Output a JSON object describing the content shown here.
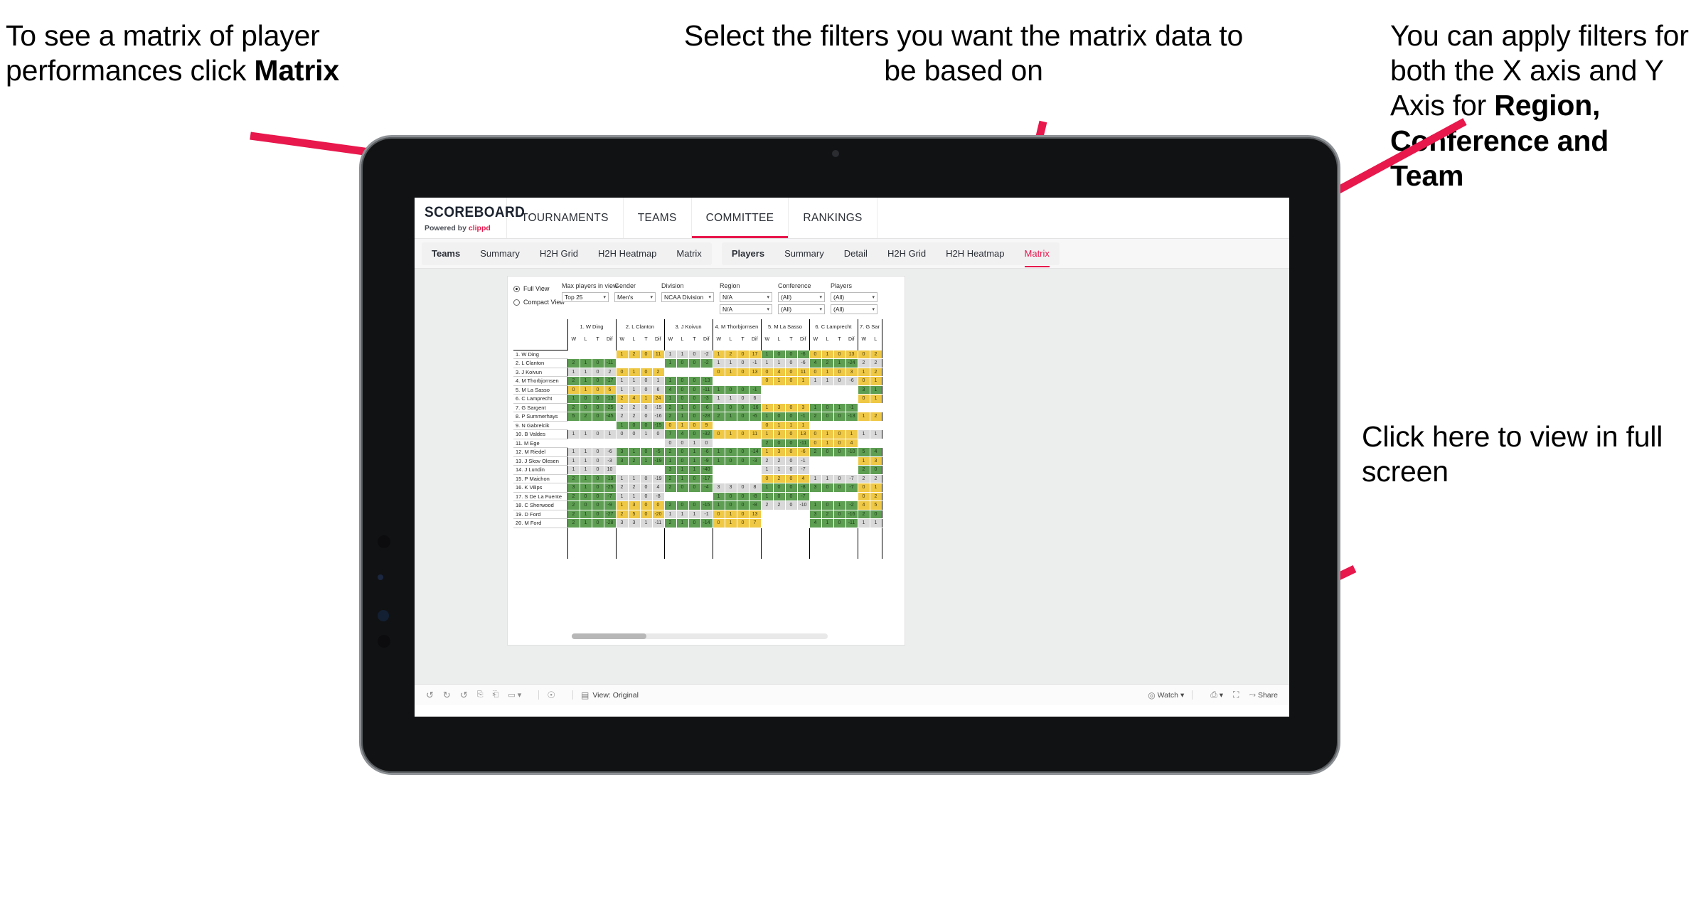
{
  "annotations": {
    "matrix_hint_pre": "To see a matrix of player performances click ",
    "matrix_hint_bold": "Matrix",
    "filters_hint": "Select the filters you want the matrix data to be based on",
    "axes_hint_pre": "You  can apply filters for both the X axis and Y Axis for ",
    "axes_hint_bold": "Region, Conference and Team",
    "fullscreen_hint": "Click here to view in full screen"
  },
  "app": {
    "brand": {
      "name": "SCOREBOARD",
      "powered_prefix": "Powered by ",
      "powered_brand": "clippd"
    },
    "topnav": [
      "TOURNAMENTS",
      "TEAMS",
      "COMMITTEE",
      "RANKINGS"
    ],
    "topnav_active": "COMMITTEE",
    "subnav": {
      "teams_group": [
        "Teams",
        "Summary",
        "H2H Grid",
        "H2H Heatmap",
        "Matrix"
      ],
      "players_group": [
        "Players",
        "Summary",
        "Detail",
        "H2H Grid",
        "H2H Heatmap",
        "Matrix"
      ],
      "players_selected": "Matrix"
    }
  },
  "filters": {
    "view_modes": [
      {
        "label": "Full View",
        "selected": true
      },
      {
        "label": "Compact View",
        "selected": false
      }
    ],
    "fields": [
      {
        "label": "Max players in view",
        "value": "Top 25"
      },
      {
        "label": "Gender",
        "value": "Men's"
      },
      {
        "label": "Division",
        "value": "NCAA Division I"
      },
      {
        "label": "Region",
        "value": "N/A",
        "value2": "N/A"
      },
      {
        "label": "Conference",
        "value": "(All)",
        "value2": "(All)"
      },
      {
        "label": "Players",
        "value": "(All)",
        "value2": "(All)"
      }
    ]
  },
  "matrix": {
    "sub_headers": [
      "W",
      "L",
      "T",
      "Dif"
    ],
    "columns": [
      {
        "name": "1. W Ding",
        "subs": [
          "W",
          "L",
          "T",
          "Dif"
        ]
      },
      {
        "name": "2. L Clanton",
        "subs": [
          "W",
          "L",
          "T",
          "Dif"
        ]
      },
      {
        "name": "3. J Koivun",
        "subs": [
          "W",
          "L",
          "T",
          "Dif"
        ]
      },
      {
        "name": "4. M Thorbjornsen",
        "subs": [
          "W",
          "L",
          "T",
          "Dif"
        ]
      },
      {
        "name": "5. M La Sasso",
        "subs": [
          "W",
          "L",
          "T",
          "Dif"
        ]
      },
      {
        "name": "6. C Lamprecht",
        "subs": [
          "W",
          "L",
          "T",
          "Dif"
        ]
      },
      {
        "name": "7. G Sar",
        "subs": [
          "W",
          "L"
        ]
      }
    ],
    "rows": [
      {
        "label": "1. W Ding",
        "cells": [
          [
            "",
            "",
            "",
            ""
          ],
          [
            "1",
            "2",
            "0",
            "11"
          ],
          [
            "1",
            "1",
            "0",
            "-2"
          ],
          [
            "1",
            "2",
            "0",
            "17"
          ],
          [
            "1",
            "0",
            "0",
            "-6"
          ],
          [
            "0",
            "1",
            "0",
            "13"
          ],
          [
            "0",
            "2"
          ]
        ],
        "colors": [
          "e",
          "y",
          "n",
          "y",
          "g",
          "y",
          "y"
        ]
      },
      {
        "label": "2. L Clanton",
        "cells": [
          [
            "2",
            "1",
            "0",
            "-11"
          ],
          [
            "",
            "",
            "",
            ""
          ],
          [
            "1",
            "0",
            "0",
            "-2"
          ],
          [
            "1",
            "1",
            "0",
            "-1"
          ],
          [
            "1",
            "1",
            "0",
            "-6"
          ],
          [
            "4",
            "2",
            "1",
            "-24"
          ],
          [
            "2",
            "2"
          ]
        ],
        "colors": [
          "g",
          "e",
          "g",
          "n",
          "n",
          "g",
          "n"
        ]
      },
      {
        "label": "3. J Koivun",
        "cells": [
          [
            "1",
            "1",
            "0",
            "2"
          ],
          [
            "0",
            "1",
            "0",
            "2"
          ],
          [
            "",
            "",
            "",
            ""
          ],
          [
            "0",
            "1",
            "0",
            "13"
          ],
          [
            "0",
            "4",
            "0",
            "11"
          ],
          [
            "0",
            "1",
            "0",
            "3"
          ],
          [
            "1",
            "2"
          ]
        ],
        "colors": [
          "n",
          "y",
          "e",
          "y",
          "y",
          "y",
          "y"
        ]
      },
      {
        "label": "4. M Thorbjornsen",
        "cells": [
          [
            "2",
            "1",
            "0",
            "-17"
          ],
          [
            "1",
            "1",
            "0",
            "1"
          ],
          [
            "1",
            "0",
            "0",
            "-13"
          ],
          [
            "",
            "",
            "",
            ""
          ],
          [
            "0",
            "1",
            "0",
            "1"
          ],
          [
            "1",
            "1",
            "0",
            "-6"
          ],
          [
            "0",
            "1"
          ]
        ],
        "colors": [
          "g",
          "n",
          "g",
          "e",
          "y",
          "n",
          "y"
        ]
      },
      {
        "label": "5. M La Sasso",
        "cells": [
          [
            "0",
            "1",
            "0",
            "6"
          ],
          [
            "1",
            "1",
            "0",
            "6"
          ],
          [
            "4",
            "0",
            "0",
            "-11"
          ],
          [
            "1",
            "0",
            "0",
            "-1"
          ],
          [
            "",
            "",
            "",
            ""
          ],
          [
            "",
            "",
            "",
            ""
          ],
          [
            "3",
            "1"
          ]
        ],
        "colors": [
          "y",
          "n",
          "g",
          "g",
          "e",
          "e",
          "g"
        ]
      },
      {
        "label": "6. C Lamprecht",
        "cells": [
          [
            "1",
            "0",
            "0",
            "-13"
          ],
          [
            "2",
            "4",
            "1",
            "24"
          ],
          [
            "1",
            "0",
            "0",
            "-3"
          ],
          [
            "1",
            "1",
            "0",
            "6"
          ],
          [
            "",
            "",
            "",
            ""
          ],
          [
            "",
            "",
            "",
            ""
          ],
          [
            "0",
            "1"
          ]
        ],
        "colors": [
          "g",
          "y",
          "g",
          "n",
          "e",
          "e",
          "y"
        ]
      },
      {
        "label": "7. G Sargent",
        "cells": [
          [
            "2",
            "0",
            "0",
            "-25"
          ],
          [
            "2",
            "2",
            "0",
            "-15"
          ],
          [
            "2",
            "1",
            "0",
            "-6"
          ],
          [
            "1",
            "0",
            "0",
            "-16"
          ],
          [
            "1",
            "3",
            "0",
            "3"
          ],
          [
            "1",
            "0",
            "1",
            "-1"
          ],
          [
            "",
            ""
          ]
        ],
        "colors": [
          "g",
          "n",
          "g",
          "g",
          "y",
          "g",
          "e"
        ]
      },
      {
        "label": "8. P Summerhays",
        "cells": [
          [
            "5",
            "2",
            "0",
            "-45"
          ],
          [
            "2",
            "2",
            "0",
            "-16"
          ],
          [
            "2",
            "1",
            "0",
            "-28"
          ],
          [
            "2",
            "1",
            "0",
            "-6"
          ],
          [
            "1",
            "0",
            "0",
            "-1"
          ],
          [
            "2",
            "0",
            "0",
            "-13"
          ],
          [
            "1",
            "2"
          ]
        ],
        "colors": [
          "g",
          "n",
          "g",
          "g",
          "g",
          "g",
          "y"
        ]
      },
      {
        "label": "9. N Gabrelcik",
        "cells": [
          [
            "",
            "",
            "",
            ""
          ],
          [
            "1",
            "0",
            "0",
            "-15"
          ],
          [
            "0",
            "1",
            "0",
            "9"
          ],
          [
            "",
            "",
            "",
            ""
          ],
          [
            "0",
            "1",
            "1",
            "1"
          ],
          [
            "",
            "",
            "",
            ""
          ],
          [
            "",
            ""
          ]
        ],
        "colors": [
          "e",
          "g",
          "y",
          "e",
          "y",
          "e",
          "e"
        ]
      },
      {
        "label": "10. B Valdes",
        "cells": [
          [
            "1",
            "1",
            "0",
            "1"
          ],
          [
            "0",
            "0",
            "1",
            "0"
          ],
          [
            "7",
            "4",
            "0",
            "-32"
          ],
          [
            "0",
            "1",
            "0",
            "11"
          ],
          [
            "1",
            "3",
            "0",
            "13"
          ],
          [
            "0",
            "1",
            "0",
            "1"
          ],
          [
            "1",
            "1"
          ]
        ],
        "colors": [
          "n",
          "n",
          "g",
          "y",
          "y",
          "y",
          "n"
        ]
      },
      {
        "label": "11. M Ege",
        "cells": [
          [
            "",
            "",
            "",
            ""
          ],
          [
            "",
            "",
            "",
            ""
          ],
          [
            "0",
            "0",
            "1",
            "0"
          ],
          [
            "",
            "",
            "",
            ""
          ],
          [
            "2",
            "0",
            "0",
            "-11"
          ],
          [
            "0",
            "1",
            "0",
            "4"
          ],
          [
            "",
            ""
          ]
        ],
        "colors": [
          "e",
          "e",
          "n",
          "e",
          "g",
          "y",
          "e"
        ]
      },
      {
        "label": "12. M Riedel",
        "cells": [
          [
            "1",
            "1",
            "0",
            "-6"
          ],
          [
            "3",
            "1",
            "0",
            "-5"
          ],
          [
            "2",
            "0",
            "1",
            "-6"
          ],
          [
            "1",
            "0",
            "0",
            "-14"
          ],
          [
            "1",
            "3",
            "0",
            "-6"
          ],
          [
            "2",
            "0",
            "0",
            "-10"
          ],
          [
            "5",
            "4"
          ]
        ],
        "colors": [
          "n",
          "g",
          "g",
          "g",
          "y",
          "g",
          "g"
        ]
      },
      {
        "label": "13. J Skov Olesen",
        "cells": [
          [
            "1",
            "1",
            "0",
            "-3"
          ],
          [
            "3",
            "2",
            "1",
            "-19"
          ],
          [
            "1",
            "0",
            "1",
            "-9"
          ],
          [
            "1",
            "0",
            "0",
            "-3"
          ],
          [
            "2",
            "2",
            "0",
            "-1"
          ],
          [
            "",
            "",
            "",
            ""
          ],
          [
            "1",
            "3"
          ]
        ],
        "colors": [
          "n",
          "g",
          "g",
          "g",
          "n",
          "e",
          "y"
        ]
      },
      {
        "label": "14. J Lundin",
        "cells": [
          [
            "1",
            "1",
            "0",
            "10"
          ],
          [
            "",
            "",
            "",
            ""
          ],
          [
            "3",
            "1",
            "1",
            "-40"
          ],
          [
            "",
            "",
            "",
            ""
          ],
          [
            "1",
            "1",
            "0",
            "-7"
          ],
          [
            "",
            "",
            "",
            ""
          ],
          [
            "2",
            "0"
          ]
        ],
        "colors": [
          "n",
          "e",
          "g",
          "e",
          "n",
          "e",
          "g"
        ]
      },
      {
        "label": "15. P Maichon",
        "cells": [
          [
            "2",
            "1",
            "0",
            "-19"
          ],
          [
            "1",
            "1",
            "0",
            "-19"
          ],
          [
            "2",
            "1",
            "0",
            "-17"
          ],
          [
            "",
            "",
            "",
            ""
          ],
          [
            "0",
            "2",
            "0",
            "4"
          ],
          [
            "1",
            "1",
            "0",
            "-7"
          ],
          [
            "2",
            "2"
          ]
        ],
        "colors": [
          "g",
          "n",
          "g",
          "e",
          "y",
          "n",
          "n"
        ]
      },
      {
        "label": "16. K Vilips",
        "cells": [
          [
            "3",
            "1",
            "0",
            "-25"
          ],
          [
            "2",
            "2",
            "0",
            "4"
          ],
          [
            "2",
            "0",
            "0",
            "-4"
          ],
          [
            "3",
            "3",
            "0",
            "8"
          ],
          [
            "1",
            "0",
            "0",
            "-8"
          ],
          [
            "3",
            "0",
            "0",
            "-7"
          ],
          [
            "0",
            "1"
          ]
        ],
        "colors": [
          "g",
          "n",
          "g",
          "n",
          "g",
          "g",
          "y"
        ]
      },
      {
        "label": "17. S De La Fuente",
        "cells": [
          [
            "2",
            "0",
            "0",
            "-7"
          ],
          [
            "1",
            "1",
            "0",
            "-8"
          ],
          [
            "",
            "",
            "",
            ""
          ],
          [
            "1",
            "0",
            "0",
            "-8"
          ],
          [
            "1",
            "0",
            "0",
            "-7"
          ],
          [
            "",
            "",
            "",
            ""
          ],
          [
            "0",
            "2"
          ]
        ],
        "colors": [
          "g",
          "n",
          "e",
          "g",
          "g",
          "e",
          "y"
        ]
      },
      {
        "label": "18. C Sherwood",
        "cells": [
          [
            "2",
            "0",
            "0",
            "-9"
          ],
          [
            "1",
            "3",
            "0",
            "0"
          ],
          [
            "2",
            "0",
            "0",
            "-15"
          ],
          [
            "1",
            "0",
            "0",
            "-8"
          ],
          [
            "2",
            "2",
            "0",
            "-10"
          ],
          [
            "1",
            "0",
            "1",
            "-2"
          ],
          [
            "4",
            "5"
          ]
        ],
        "colors": [
          "g",
          "y",
          "g",
          "g",
          "n",
          "g",
          "y"
        ]
      },
      {
        "label": "19. D Ford",
        "cells": [
          [
            "2",
            "1",
            "0",
            "-27"
          ],
          [
            "2",
            "5",
            "0",
            "-20"
          ],
          [
            "1",
            "1",
            "1",
            "-1"
          ],
          [
            "0",
            "1",
            "0",
            "13"
          ],
          [
            "",
            "",
            "",
            ""
          ],
          [
            "3",
            "2",
            "0",
            "-16"
          ],
          [
            "2",
            "0"
          ]
        ],
        "colors": [
          "g",
          "y",
          "n",
          "y",
          "e",
          "g",
          "g"
        ]
      },
      {
        "label": "20. M Ford",
        "cells": [
          [
            "2",
            "1",
            "0",
            "-28"
          ],
          [
            "3",
            "3",
            "1",
            "-11"
          ],
          [
            "2",
            "1",
            "0",
            "-14"
          ],
          [
            "0",
            "1",
            "0",
            "7"
          ],
          [
            "",
            "",
            "",
            ""
          ],
          [
            "4",
            "1",
            "0",
            "-11"
          ],
          [
            "1",
            "1"
          ]
        ],
        "colors": [
          "g",
          "n",
          "g",
          "y",
          "e",
          "g",
          "n"
        ]
      }
    ]
  },
  "bottombar": {
    "view_label": "View: Original",
    "watch_label": "Watch",
    "share_label": "Share",
    "icons": [
      "undo-icon",
      "redo-icon",
      "refresh-icon",
      "pause-icon",
      "resume-icon",
      "device-icon",
      "revert-icon",
      "help-icon"
    ]
  },
  "colors": {
    "accent": "#e8174c",
    "green": "#5d9e52",
    "yellow": "#efc845",
    "grey": "#d9d9d9"
  }
}
